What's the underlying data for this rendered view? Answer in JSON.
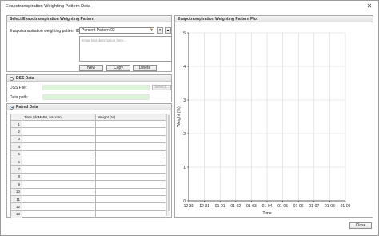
{
  "window": {
    "title": "Evapotranspiration Weighting Pattern Data",
    "close_glyph": "✕"
  },
  "select_group": {
    "title": "Select Evapotranspiration Weighting Pattern",
    "pattern_label": "Evapotranspiration weighting pattern ID:",
    "pattern_value": "Percent Pattern 02",
    "description_placeholder": "Enter text description here...",
    "buttons": {
      "new": "New",
      "copy": "Copy",
      "delete": "Delete"
    }
  },
  "dss_group": {
    "title": "DSS Data",
    "selected": false,
    "file_label": "DSS File:",
    "path_label": "Data path:",
    "select_button": "Select..."
  },
  "paired_group": {
    "title": "Paired Data",
    "selected": true,
    "columns": [
      "Time (ddMMM, HH:mm)",
      "Weight (%)"
    ],
    "rows": [
      "1",
      "2",
      "3",
      "4",
      "5",
      "6",
      "7",
      "8",
      "9",
      "10",
      "11",
      "12",
      "13"
    ]
  },
  "plot": {
    "title": "Evapotranspiration Weighting Pattern Plot"
  },
  "chart_data": {
    "type": "line",
    "xlabel": "Time",
    "ylabel": "Weight (%)",
    "x_ticks": [
      "12-30",
      "12-31",
      "01-01",
      "01-02",
      "01-03",
      "01-04",
      "01-05",
      "01-06",
      "01-07",
      "01-08",
      "01-09"
    ],
    "y_ticks": [
      0,
      1,
      2,
      3,
      4,
      5
    ],
    "ylim": [
      0,
      5
    ],
    "grid": true,
    "series": []
  },
  "footer": {
    "close_button": "Close"
  }
}
